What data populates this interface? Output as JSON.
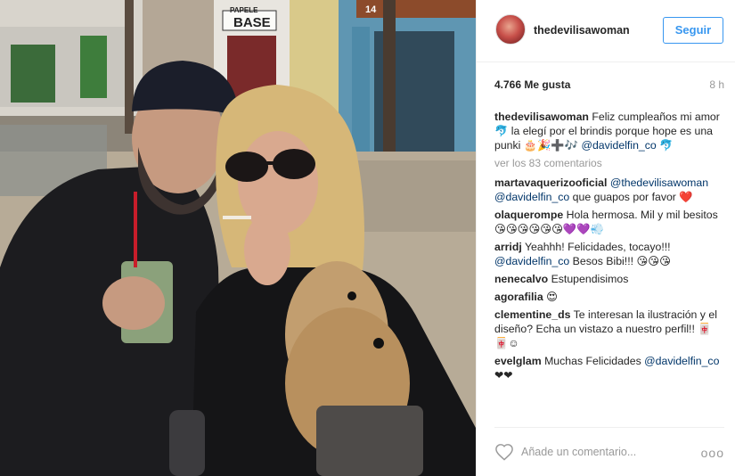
{
  "post": {
    "username": "thedevilisawoman",
    "follow_label": "Seguir",
    "likes": "4.766 Me gusta",
    "time_ago": "8 h",
    "photo_signs": {
      "shop_left": "PAPELE",
      "shop_base": "BASE",
      "shop_number": "14"
    }
  },
  "comments": {
    "view_all": "ver los 83 comentarios",
    "items": [
      {
        "user": "thedevilisawoman",
        "text": "Feliz cumpleaños mi amor🐬 la elegí por el brindis porque hope es una punki 🎂🎉➕🎶 ",
        "mention": "@davidelfin_co",
        "tail": "🐬"
      },
      {
        "user": "martavaquerizooficial",
        "mention": "@thedevilisawoman @davidelfin_co",
        "text": " que guapos por favor ❤️"
      },
      {
        "user": "olaquerompe",
        "text": "Hola hermosa. Mil y mil besitos 😘😘😘😘😘😘💜💜💨"
      },
      {
        "user": "arridj",
        "text": "Yeahhh! Felicidades, tocayo!!! ",
        "mention": "@davidelfin_co",
        "tail": " Besos Bibi!!! 😘😘😘"
      },
      {
        "user": "nenecalvo",
        "text": "Estupendisimos"
      },
      {
        "user": "agorafilia",
        "text": "😍"
      },
      {
        "user": "clementine_ds",
        "text": "Te interesan la ilustración y el diseño? Echa un vistazo a nuestro perfil!! 🀄🀄☺"
      },
      {
        "user": "evelglam",
        "text": "Muchas Felicidades ",
        "mention": "@davidelfin_co",
        "tail": " ❤❤"
      }
    ]
  },
  "footer": {
    "add_comment_placeholder": "Añade un comentario...",
    "more_label": "ooo"
  },
  "colors": {
    "accent": "#3897f0",
    "mention": "#003569",
    "muted": "#999999"
  },
  "icons": {
    "like": "heart-icon",
    "more": "more-options-icon"
  }
}
